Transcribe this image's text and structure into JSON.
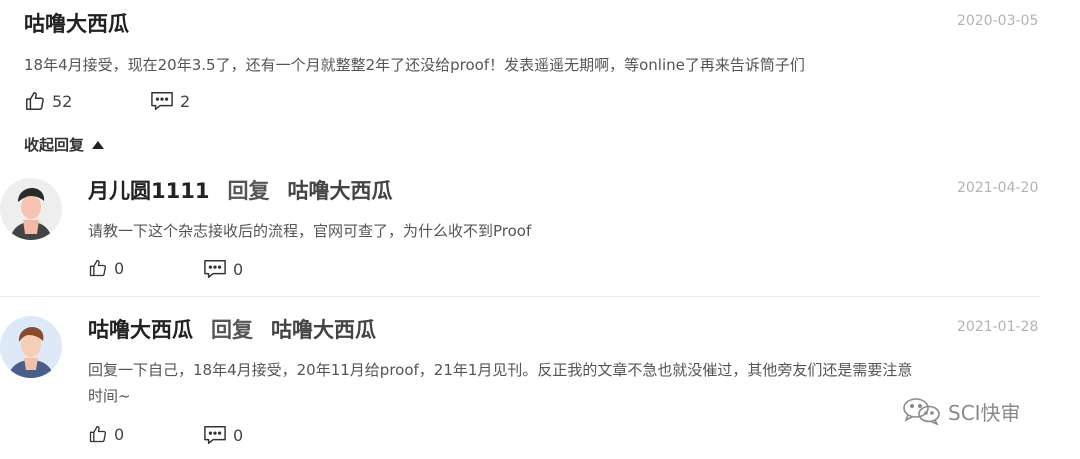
{
  "top_comment": {
    "user": "咕噜大西瓜",
    "date": "2020-03-05",
    "text": "18年4月接受，现在20年3.5了，还有一个月就整整2年了还没给proof！发表遥遥无期啊，等online了再来告诉筒子们",
    "likes": "52",
    "comments": "2",
    "like_icon": "thumbs-up-icon",
    "comment_icon": "comment-icon"
  },
  "collapse_label": "收起回复",
  "replies": [
    {
      "user": "月儿圆1111",
      "reply_word": "回复",
      "reply_to": "咕噜大西瓜",
      "date": "2021-04-20",
      "text": "请教一下这个杂志接收后的流程，官网可查了，为什么收不到Proof",
      "likes": "0",
      "comments": "0"
    },
    {
      "user": "咕噜大西瓜",
      "reply_word": "回复",
      "reply_to": "咕噜大西瓜",
      "date": "2021-01-28",
      "text_line1": "回复一下自己，18年4月接受，20年11月给proof，21年1月见刊。反正我的文章不急也就没催过，其他旁友们还是需要注意",
      "text_line2": "时间~",
      "likes": "0",
      "comments": "0"
    }
  ],
  "watermark": "SCI快审",
  "colors": {
    "date": "#b3b3b3",
    "text": "#555555",
    "divider": "#ececec"
  }
}
